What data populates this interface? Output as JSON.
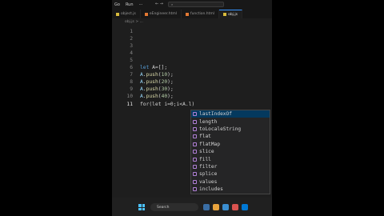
{
  "menu": {
    "go": "Go",
    "run": "Run",
    "arrows": "← →",
    "search_placeholder": "⌕"
  },
  "tabs": [
    {
      "label": "object.js"
    },
    {
      "label": "eEngineer.html"
    },
    {
      "label": "function.html"
    },
    {
      "label": "obj.js"
    }
  ],
  "breadcrumb": "obj.js > ...",
  "editor": {
    "lines": [
      {
        "n": "1"
      },
      {
        "n": "2"
      },
      {
        "n": "3"
      },
      {
        "n": "4"
      },
      {
        "n": "5"
      },
      {
        "n": "6",
        "kw": "let",
        "rest": " A=[];"
      },
      {
        "n": "7",
        "obj": "A",
        "dot": ".",
        "method": "push",
        "arg": "10",
        "tail": ");"
      },
      {
        "n": "8",
        "obj": "A",
        "dot": ".",
        "method": "push",
        "arg": "20",
        "tail": ");"
      },
      {
        "n": "9",
        "obj": "A",
        "dot": ".",
        "method": "push",
        "arg": "30",
        "tail": ");"
      },
      {
        "n": "10",
        "obj": "A",
        "dot": ".",
        "method": "push",
        "arg": "40",
        "tail": ");"
      },
      {
        "n": "11",
        "text": "for(let i=0;i<A.l)"
      }
    ]
  },
  "suggestions": [
    "lastIndexOf",
    "length",
    "toLocaleString",
    "flat",
    "flatMap",
    "slice",
    "fill",
    "filter",
    "splice",
    "values",
    "includes"
  ],
  "taskbar": {
    "search": "Search"
  },
  "colors": {
    "accent": "#3794ff",
    "selection": "#04395e",
    "method_icon": "#b180d7"
  }
}
